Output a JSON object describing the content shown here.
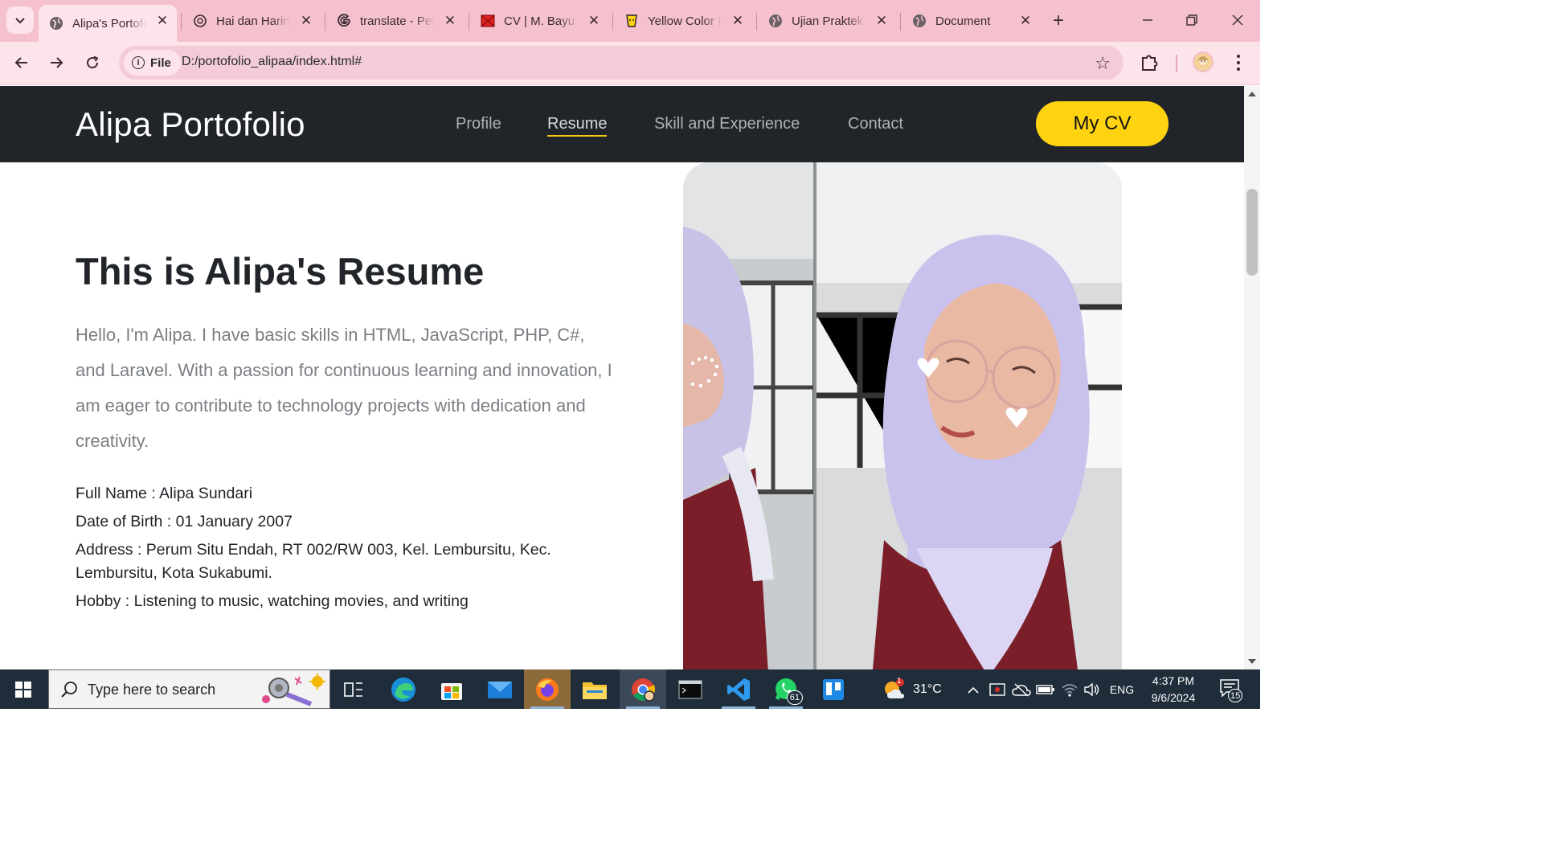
{
  "browser": {
    "tabs": [
      {
        "title": "Alipa's Portofolio",
        "active": true,
        "favicon": "globe-icon"
      },
      {
        "title": "Hai dan Harim",
        "active": false,
        "favicon": "openai-icon"
      },
      {
        "title": "translate - Per",
        "active": false,
        "favicon": "google-icon"
      },
      {
        "title": "CV | M. Bayu S",
        "active": false,
        "favicon": "red-box-icon"
      },
      {
        "title": "Yellow Color P",
        "active": false,
        "favicon": "cup-icon"
      },
      {
        "title": "Ujian Praktek",
        "active": false,
        "favicon": "globe-icon"
      },
      {
        "title": "Document",
        "active": false,
        "favicon": "globe-icon"
      }
    ],
    "address": {
      "scheme_label": "File",
      "url": "D:/portofolio_alipaa/index.html#"
    }
  },
  "site": {
    "brand": "Alipa Portofolio",
    "nav": [
      {
        "label": "Profile",
        "active": false
      },
      {
        "label": "Resume",
        "active": true
      },
      {
        "label": "Skill and Experience",
        "active": false
      },
      {
        "label": "Contact",
        "active": false
      }
    ],
    "cv_button": "My CV",
    "resume": {
      "heading": "This is Alipa's Resume",
      "intro": "Hello, I'm Alipa. I have basic skills in HTML, JavaScript, PHP, C#, and Laravel. With a passion for continuous learning and innovation, I am eager to contribute to technology projects with dedication and creativity.",
      "full_name": "Full Name : Alipa Sundari",
      "birth": "Date of Birth : 01 January 2007",
      "address": "Address : Perum Situ Endah, RT 002/RW 003, Kel. Lembursitu, Kec. Lembursitu, Kota Sukabumi.",
      "hobby": "Hobby : Listening to music, watching movies, and writing"
    }
  },
  "taskbar": {
    "search_placeholder": "Type here to search",
    "whatsapp_badge": "61",
    "weather_badge": "1",
    "temperature": "31°C",
    "language": "ENG",
    "time": "4:37 PM",
    "date": "9/6/2024",
    "notifications": "15"
  },
  "colors": {
    "tabbar": "#f6c1cf",
    "toolbar": "#fde3ea",
    "nav_bg": "#212529",
    "accent_yellow": "#ffd30f",
    "intro_text": "#7b7f84",
    "taskbar": "#1f2c3a"
  }
}
